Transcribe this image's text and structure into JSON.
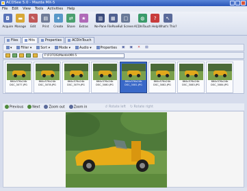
{
  "window": {
    "title": "ACDSee 5.0 - Mazda MX-5"
  },
  "menu": [
    "File",
    "Edit",
    "View",
    "Tools",
    "Activities",
    "Help"
  ],
  "toolbar": [
    {
      "label": "Acquire",
      "icon": "camera-icon",
      "color": "#5a74b8"
    },
    {
      "label": "Manage",
      "icon": "folder-icon",
      "color": "#d8a838"
    },
    {
      "label": "Edit",
      "icon": "pencil-icon",
      "color": "#c05858"
    },
    {
      "label": "Print",
      "icon": "printer-icon",
      "color": "#707c98"
    },
    {
      "label": "Create",
      "icon": "create-icon",
      "color": "#5898c8"
    },
    {
      "label": "Share",
      "icon": "share-icon",
      "color": "#4aa070"
    },
    {
      "label": "Extras",
      "icon": "extras-icon",
      "color": "#b06ab8"
    },
    {
      "label": "Ne-Pane",
      "icon": "pane-icon",
      "color": "#3c4c7c"
    },
    {
      "label": "FilePane",
      "icon": "filepane-icon",
      "color": "#506090"
    },
    {
      "label": "Full Screen",
      "icon": "fullscreen-icon",
      "color": "#6a7a98"
    },
    {
      "label": "ACDInTouch",
      "icon": "globe-icon",
      "color": "#3a9a6a"
    },
    {
      "label": "Help",
      "icon": "help-icon",
      "color": "#c83c3c"
    },
    {
      "label": "What's This?",
      "icon": "whatsthis-icon",
      "color": "#5a6a9a"
    }
  ],
  "tabs": [
    {
      "label": "Files",
      "active": false
    },
    {
      "label": "Hits",
      "active": true
    },
    {
      "label": "Properties",
      "active": false
    },
    {
      "label": "ACDInTouch",
      "active": false
    }
  ],
  "subtoolbar": {
    "filter": "Filter",
    "sort": "Sort",
    "mode": "Mode",
    "audio": "Audio",
    "properties": "Properties"
  },
  "address": {
    "path": "F:\\FOTOS\\Mazda\\MX-5"
  },
  "thumbnails": [
    {
      "dims": "864x576x24b",
      "name": "DSC_3077.JPG",
      "selected": false
    },
    {
      "dims": "864x576x24b",
      "name": "DSC_3078.JPG",
      "selected": false
    },
    {
      "dims": "864x576x24b",
      "name": "DSC_3079.JPG",
      "selected": false
    },
    {
      "dims": "864x576x24b",
      "name": "DSC_3080.JPG",
      "selected": false
    },
    {
      "dims": "864x576x24b",
      "name": "DSC_3081.JPG",
      "selected": true
    },
    {
      "dims": "864x576x24b",
      "name": "DSC_3082.JPG",
      "selected": false
    },
    {
      "dims": "864x576x24b",
      "name": "DSC_3083.JPG",
      "selected": false
    },
    {
      "dims": "864x576x24b",
      "name": "DSC_3084.JPG",
      "selected": false
    }
  ],
  "viewer_nav": {
    "previous": "Previous",
    "next": "Next",
    "zoom_out": "Zoom out",
    "zoom_in": "Zoom in",
    "rotate_left": "Rotate left",
    "rotate_right": "Rotate right"
  }
}
